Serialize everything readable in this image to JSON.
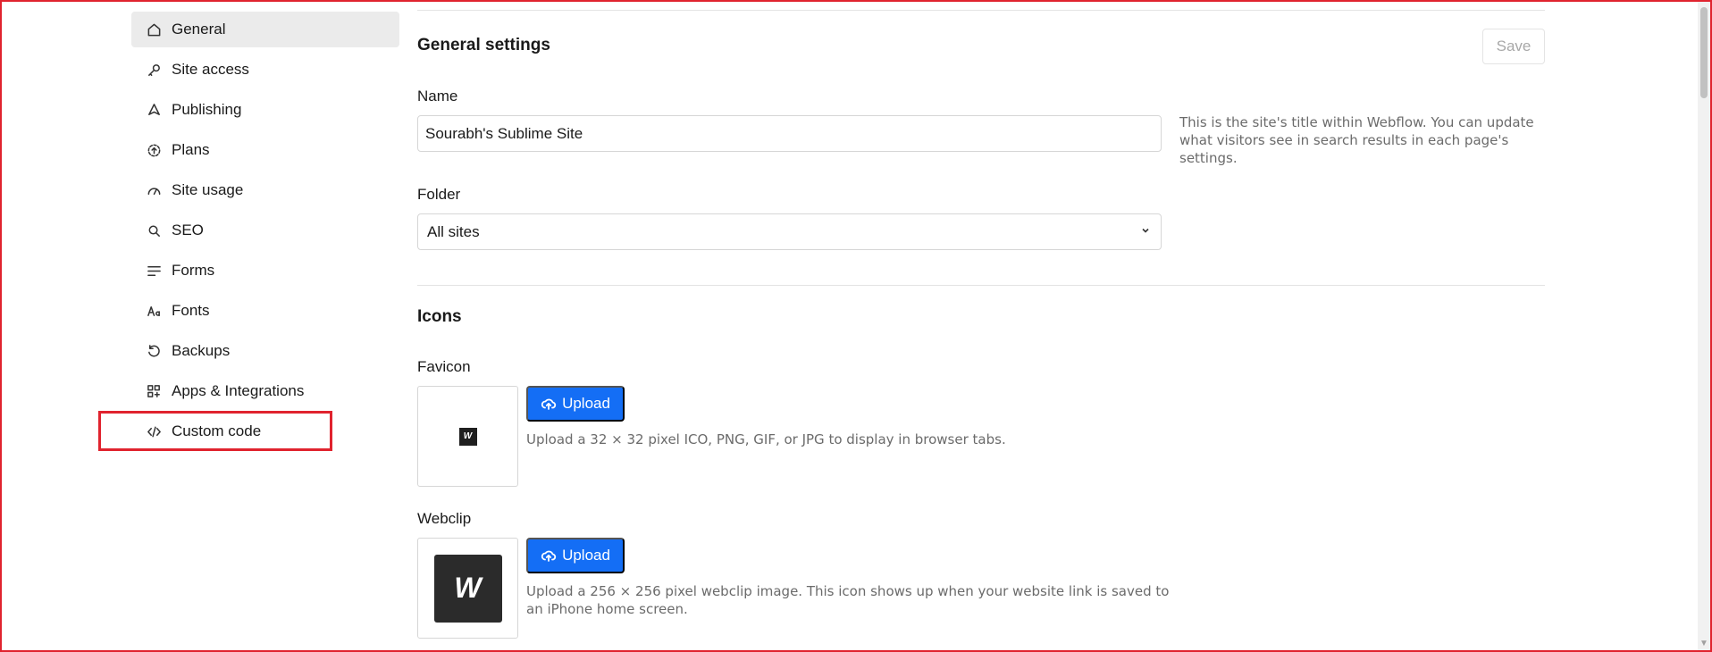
{
  "sidebar": {
    "items": [
      {
        "label": "General",
        "icon": "home-icon",
        "active": true
      },
      {
        "label": "Site access",
        "icon": "key-icon"
      },
      {
        "label": "Publishing",
        "icon": "rocket-icon"
      },
      {
        "label": "Plans",
        "icon": "plans-icon"
      },
      {
        "label": "Site usage",
        "icon": "gauge-icon"
      },
      {
        "label": "SEO",
        "icon": "search-icon"
      },
      {
        "label": "Forms",
        "icon": "forms-icon"
      },
      {
        "label": "Fonts",
        "icon": "fonts-icon"
      },
      {
        "label": "Backups",
        "icon": "backup-icon"
      },
      {
        "label": "Apps & Integrations",
        "icon": "apps-icon"
      },
      {
        "label": "Custom code",
        "icon": "code-icon"
      }
    ]
  },
  "general": {
    "title": "General settings",
    "save_label": "Save",
    "name_label": "Name",
    "name_value": "Sourabh's Sublime Site",
    "name_help": "This is the site's title within Webflow. You can update what visitors see in search results in each page's settings.",
    "folder_label": "Folder",
    "folder_value": "All sites"
  },
  "icons": {
    "title": "Icons",
    "favicon_label": "Favicon",
    "favicon_upload": "Upload",
    "favicon_desc": "Upload a 32 × 32 pixel ICO, PNG, GIF, or JPG to display in browser tabs.",
    "favicon_glyph": "W",
    "webclip_label": "Webclip",
    "webclip_upload": "Upload",
    "webclip_desc": "Upload a 256 × 256 pixel webclip image. This icon shows up when your website link is saved to an iPhone home screen.",
    "webclip_glyph": "W"
  },
  "colors": {
    "accent": "#146ef5",
    "highlight": "#e0232e"
  }
}
